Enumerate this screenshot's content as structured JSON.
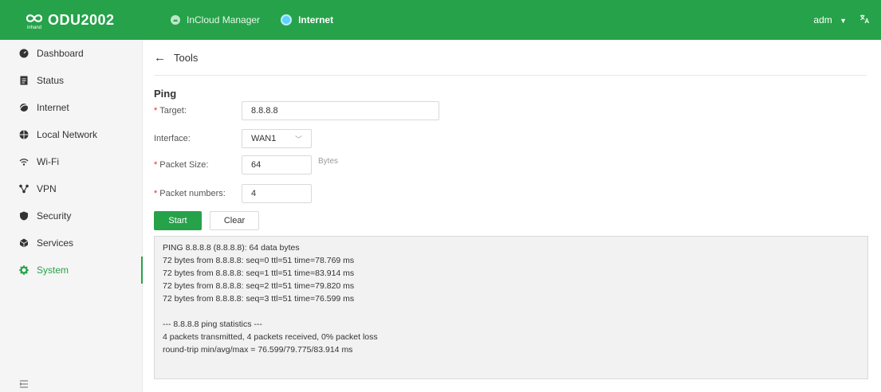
{
  "header": {
    "brand_logo_text": "inhand",
    "brand_name": "ODU2002",
    "tabs": [
      {
        "label": "InCloud Manager"
      },
      {
        "label": "Internet"
      }
    ],
    "user": "adm",
    "language_icon": "translate-icon"
  },
  "sidebar": {
    "items": [
      {
        "label": "Dashboard",
        "icon": "dashboard-icon"
      },
      {
        "label": "Status",
        "icon": "status-icon"
      },
      {
        "label": "Internet",
        "icon": "internet-icon"
      },
      {
        "label": "Local Network",
        "icon": "local-network-icon"
      },
      {
        "label": "Wi-Fi",
        "icon": "wifi-icon"
      },
      {
        "label": "VPN",
        "icon": "vpn-icon"
      },
      {
        "label": "Security",
        "icon": "security-icon"
      },
      {
        "label": "Services",
        "icon": "services-icon"
      },
      {
        "label": "System",
        "icon": "system-icon",
        "active": true
      }
    ]
  },
  "page": {
    "title": "Tools"
  },
  "ping": {
    "section_title": "Ping",
    "target_label": "Target:",
    "target_value": "8.8.8.8",
    "interface_label": "Interface:",
    "interface_value": "WAN1",
    "packet_size_label": "Packet Size:",
    "packet_size_value": "64",
    "packet_size_unit": "Bytes",
    "packet_numbers_label": "Packet numbers:",
    "packet_numbers_value": "4",
    "start_label": "Start",
    "clear_label": "Clear",
    "output_lines": [
      "PING 8.8.8.8 (8.8.8.8): 64 data bytes",
      "72 bytes from 8.8.8.8: seq=0 ttl=51 time=78.769 ms",
      "72 bytes from 8.8.8.8: seq=1 ttl=51 time=83.914 ms",
      "72 bytes from 8.8.8.8: seq=2 ttl=51 time=79.820 ms",
      "72 bytes from 8.8.8.8: seq=3 ttl=51 time=76.599 ms",
      "",
      "--- 8.8.8.8 ping statistics ---",
      "4 packets transmitted, 4 packets received, 0% packet loss",
      "round-trip min/avg/max = 76.599/79.775/83.914 ms"
    ]
  },
  "colors": {
    "brand_green": "#26a24a",
    "required_red": "#f5222d",
    "internet_dot": "#5fd0ff"
  }
}
